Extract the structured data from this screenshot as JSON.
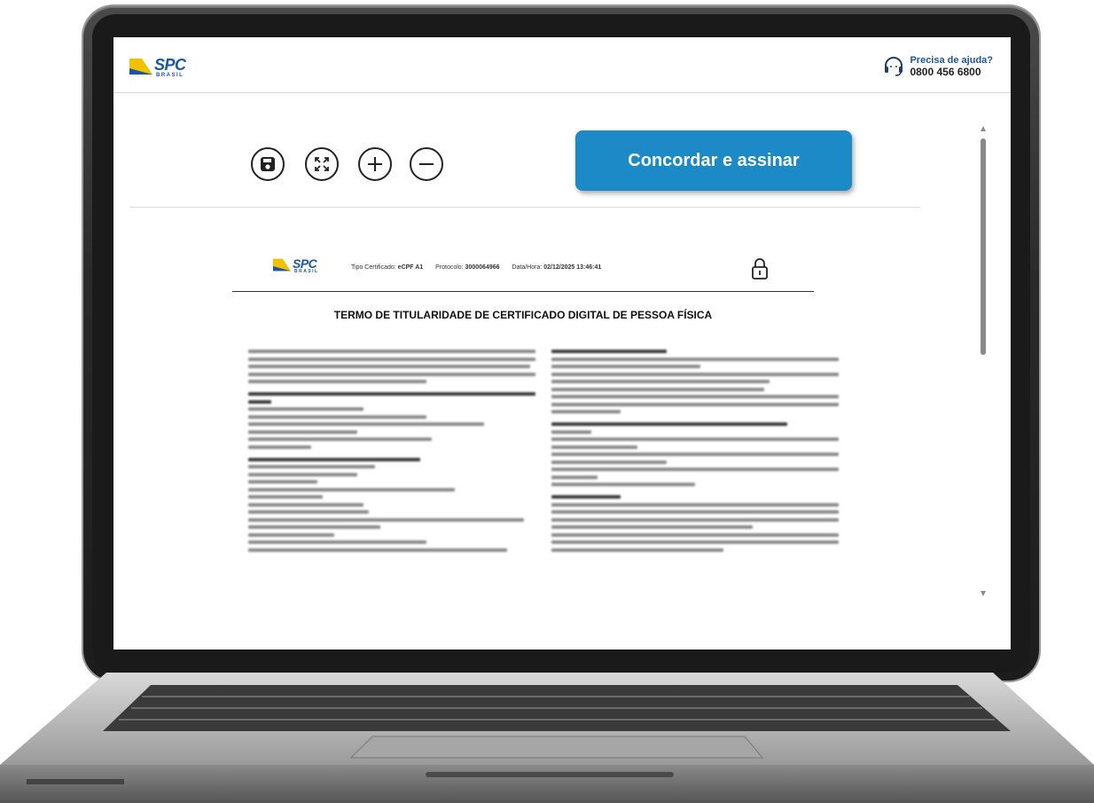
{
  "header": {
    "logo_text": "SPC",
    "logo_subtext": "BRASIL",
    "help_title": "Precisa de ajuda?",
    "help_phone": "0800 456 6800"
  },
  "toolbar": {
    "save_icon": "save-icon",
    "fullscreen_icon": "fullscreen-icon",
    "zoom_in_icon": "zoom-in-icon",
    "zoom_out_icon": "zoom-out-icon",
    "sign_button_label": "Concordar e assinar"
  },
  "document": {
    "logo_text": "SPC",
    "logo_subtext": "BRASIL",
    "cert_type_label": "Tipo Certificado:",
    "cert_type_value": "eCPF A1",
    "protocol_label": "Protocolo:",
    "protocol_value": "3000064966",
    "datetime_label": "Data/Hora:",
    "datetime_value": "02/12/2025 13:46:41",
    "title": "TERMO DE TITULARIDADE DE CERTIFICADO DIGITAL DE PESSOA FÍSICA"
  },
  "colors": {
    "brand_blue": "#1b56a3",
    "brand_yellow": "#f2c200",
    "button_blue": "#1b8ac6"
  }
}
